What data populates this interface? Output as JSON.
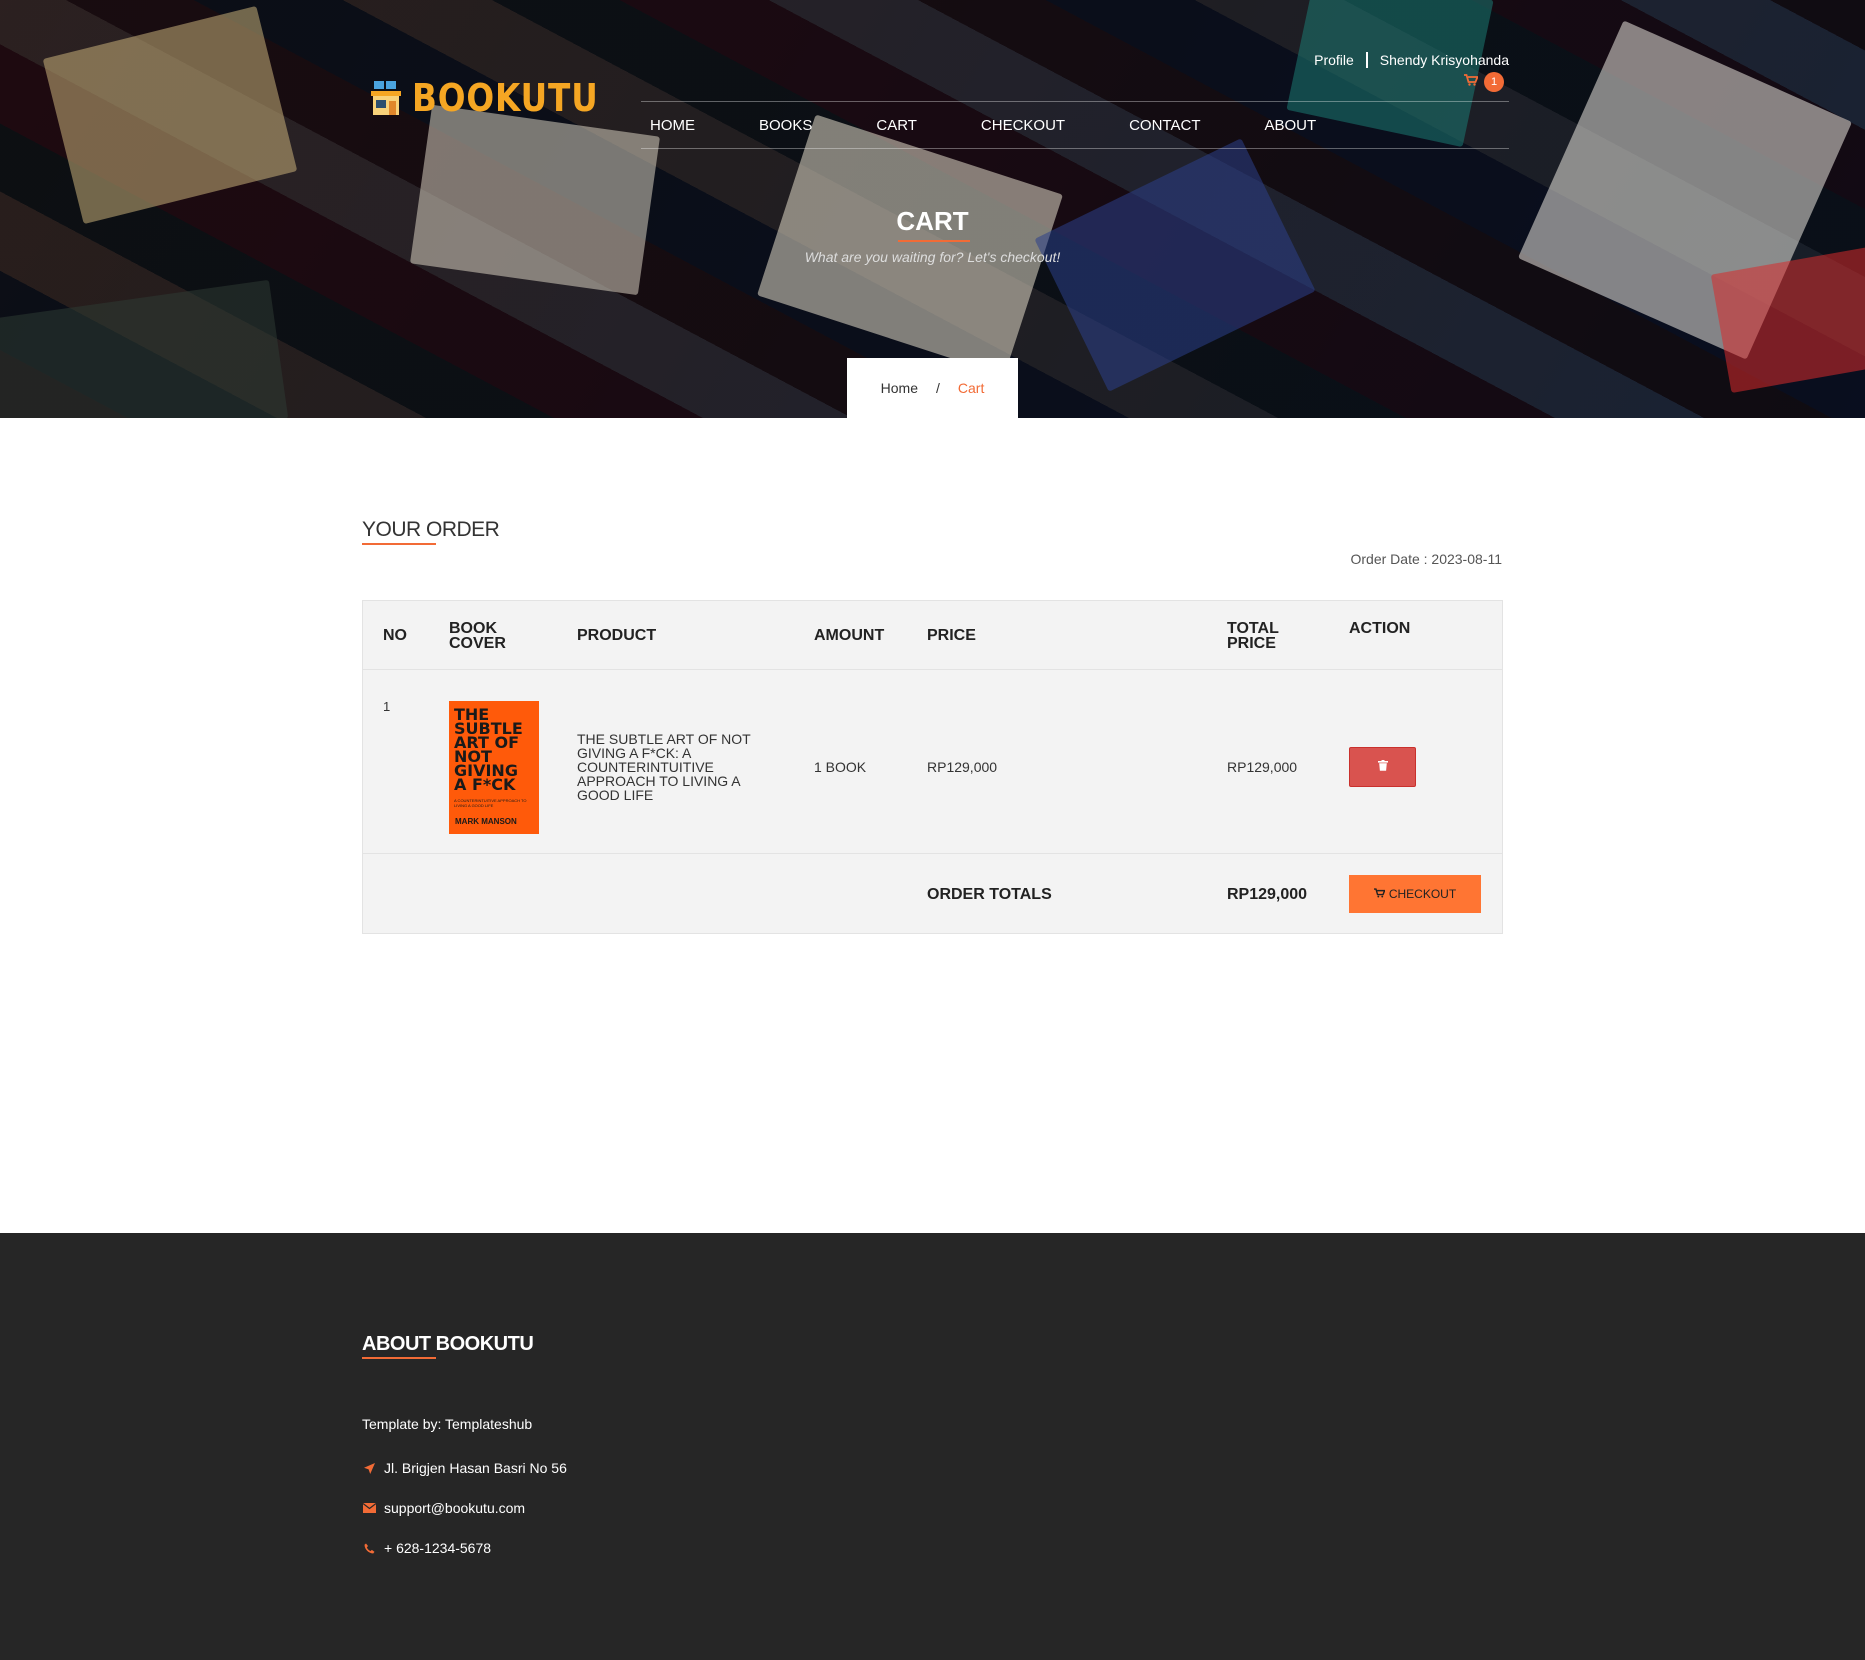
{
  "brand": {
    "name": "BOOKUTU",
    "color": "#f5a623"
  },
  "topbar": {
    "profile_label": "Profile",
    "user_name": "Shendy Krisyohanda",
    "cart_count": "1"
  },
  "nav": {
    "items": [
      "HOME",
      "BOOKS",
      "CART",
      "CHECKOUT",
      "CONTACT",
      "ABOUT"
    ]
  },
  "hero": {
    "title": "CART",
    "subtitle": "What are you waiting for? Let's checkout!"
  },
  "breadcrumb": {
    "home": "Home",
    "separator": "/",
    "current": "Cart"
  },
  "order": {
    "heading": "YOUR ORDER",
    "date_text": "Order Date : 2023-08-11",
    "columns": {
      "no": "NO",
      "cover_1": "BOOK",
      "cover_2": "COVER",
      "product": "PRODUCT",
      "amount": "AMOUNT",
      "price": "PRICE",
      "total_1": "TOTAL",
      "total_2": "PRICE",
      "action": "ACTION"
    },
    "rows": [
      {
        "no": "1",
        "cover": {
          "title": "THE SUBTLE ART OF NOT GIVING A F*CK",
          "subtitle": "A COUNTERINTUITIVE APPROACH TO LIVING A GOOD LIFE",
          "author": "MARK MANSON",
          "color": "#ff5a0a"
        },
        "product": "THE SUBTLE ART OF NOT GIVING A F*CK: A COUNTERINTUITIVE APPROACH TO LIVING A GOOD LIFE",
        "amount": "1 BOOK",
        "price": "RP129,000",
        "total_price": "RP129,000",
        "delete_icon": "trash-icon"
      }
    ],
    "totals_label": "ORDER TOTALS",
    "totals_value": "RP129,000",
    "checkout_label": "CHECKOUT",
    "checkout_icon": "cart-icon"
  },
  "footer": {
    "title": "ABOUT BOOKUTU",
    "template_credit": "Template by: Templateshub",
    "address": "Jl. Brigjen Hasan Basri No 56",
    "email": "support@bookutu.com",
    "phone": "+ 628-1234-5678"
  },
  "colors": {
    "accent": "#f26b36",
    "danger": "#d9534f",
    "checkout": "#ff7533",
    "footer_bg": "#262626"
  }
}
